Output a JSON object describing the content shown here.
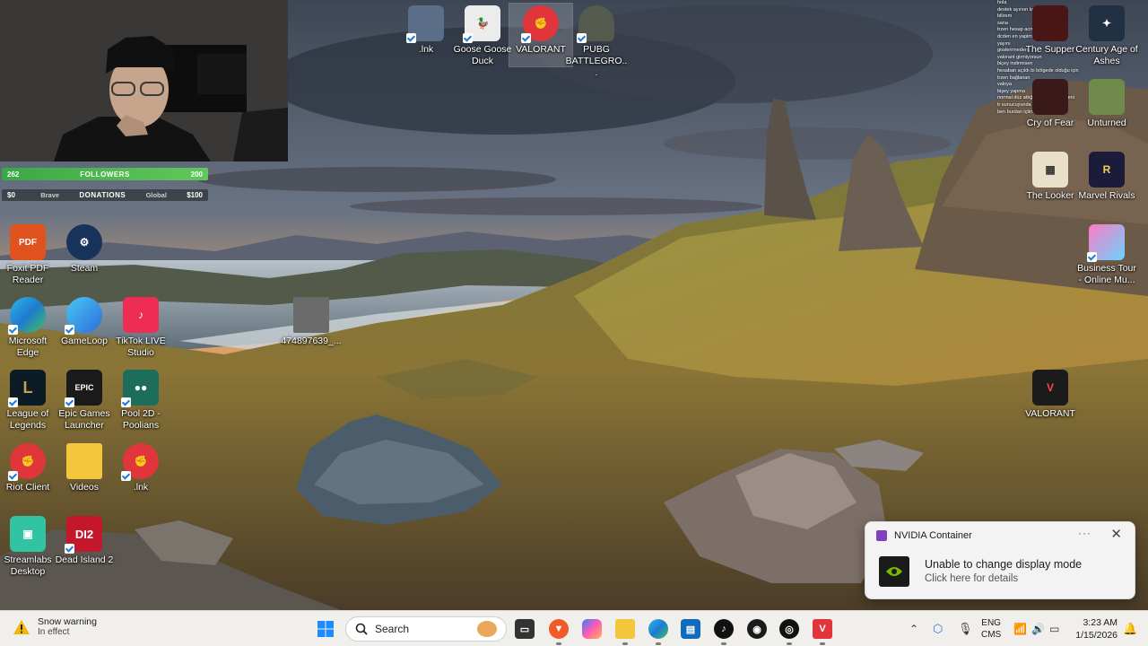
{
  "desktop": {
    "top_icons": [
      {
        "label": ".lnk"
      },
      {
        "label": "Goose Goose Duck"
      },
      {
        "label": "VALORANT"
      },
      {
        "label": "PUBG BATTLEGRO..."
      }
    ],
    "left_icons": [
      {
        "label": "Foxit PDF Reader"
      },
      {
        "label": "Steam"
      },
      {
        "label": "Microsoft Edge"
      },
      {
        "label": "GameLoop"
      },
      {
        "label": "TikTok LIVE Studio"
      },
      {
        "label": "League of Legends"
      },
      {
        "label": "Epic Games Launcher"
      },
      {
        "label": "Pool 2D - Poolians"
      },
      {
        "label": "Riot Client"
      },
      {
        "label": "Videos"
      },
      {
        "label": ".lnk"
      },
      {
        "label": "Streamlabs Desktop"
      },
      {
        "label": "Dead Island 2"
      }
    ],
    "middle_icon": {
      "label": "474897639_..."
    },
    "right_icons": [
      {
        "label": "The Supper"
      },
      {
        "label": "Century Age of Ashes"
      },
      {
        "label": "Cry of Fear"
      },
      {
        "label": "Unturned"
      },
      {
        "label": "The Looker"
      },
      {
        "label": "Marvel Rivals"
      },
      {
        "label": "Business Tour - Online Mu..."
      },
      {
        "label": "VALORANT"
      }
    ]
  },
  "overlay": {
    "followers": {
      "left": "262",
      "title": "FOLLOWERS",
      "right": "200"
    },
    "donations": {
      "left": "$0",
      "title": "DONATIONS",
      "right": "$100"
    },
    "hidden_labels": {
      "brave": "Brave",
      "global": "Global"
    },
    "chat": [
      {
        "user": "",
        "text": "hola"
      },
      {
        "user": "",
        "text": "destek ayırsın lazım"
      },
      {
        "user": "",
        "text": "bilirem"
      },
      {
        "user": "",
        "text": "sana"
      },
      {
        "user": "",
        "text": "trzen hesap acmis"
      },
      {
        "user": "",
        "text": "dcden en yapim"
      },
      {
        "user": "",
        "text": "yayını"
      },
      {
        "user": "",
        "text": "gosterrmeden"
      },
      {
        "user": "",
        "text": "valorant girmiyorsun"
      },
      {
        "user": "",
        "text": "biçey indirmisen"
      },
      {
        "user": "",
        "text": "hesaban açıldı bi bölgede olduğu için"
      },
      {
        "user": "",
        "text": "trzen bağlanan"
      },
      {
        "user": "",
        "text": "valoya"
      },
      {
        "user": "",
        "text": "bişey yapma"
      },
      {
        "user": "",
        "text": "normal düz attığın hesaptan girceni"
      },
      {
        "user": "",
        "text": "tr sunucuyunda olcak"
      },
      {
        "user": "",
        "text": "ben burdan içtim heabı"
      }
    ]
  },
  "notification": {
    "app_name": "NVIDIA Container",
    "more": "···",
    "close": "✕",
    "title": "Unable to change display mode",
    "subtitle": "Click here for details"
  },
  "taskbar": {
    "weather_title": "Snow warning",
    "weather_sub": "In effect",
    "search_placeholder": "Search",
    "language": "ENG",
    "language_sub": "CMS",
    "time": "3:23 AM",
    "date": "1/15/2026"
  }
}
